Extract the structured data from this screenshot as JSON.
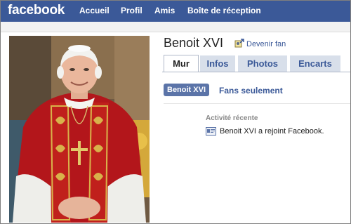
{
  "header": {
    "logo": "facebook",
    "nav": [
      "Accueil",
      "Profil",
      "Amis",
      "Boîte de réception"
    ]
  },
  "profile": {
    "name": "Benoit XVI",
    "fan_action": "Devenir fan"
  },
  "tabs": [
    "Mur",
    "Infos",
    "Photos",
    "Encarts"
  ],
  "active_tab": "Mur",
  "filters": {
    "active": "Benoit XVI",
    "other": "Fans seulement"
  },
  "wall": {
    "section_title": "Activité récente",
    "items": [
      {
        "text": "Benoit XVI a rejoint Facebook.",
        "icon": "profile-card-icon"
      }
    ]
  },
  "colors": {
    "brand": "#3b5998",
    "tab_inactive": "#d8dfea",
    "filter_active": "#5b74a8"
  },
  "icons": {
    "fan": "fan-icon",
    "activity": "profile-card-icon"
  }
}
